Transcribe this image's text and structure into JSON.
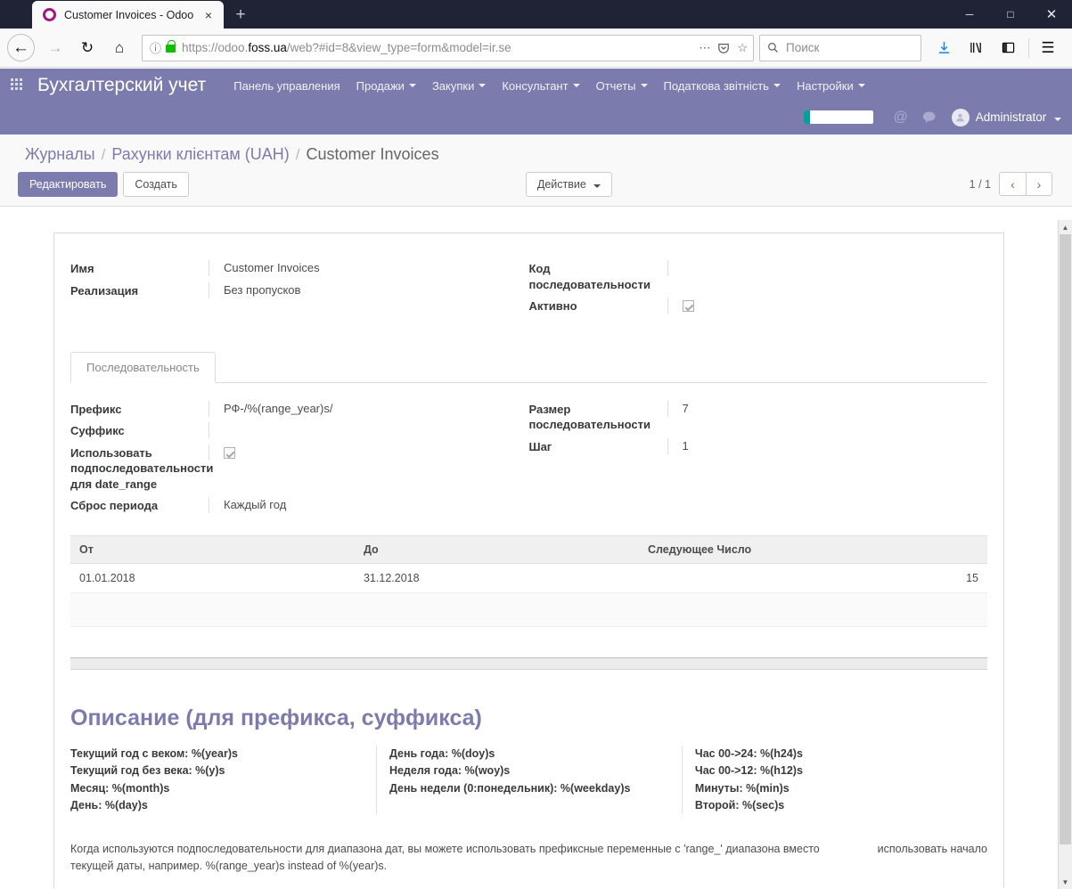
{
  "browser": {
    "tab": {
      "title": "Customer Invoices - Odoo",
      "favicon": "odoo-logo-icon",
      "close": "×"
    },
    "newtab_label": "+",
    "window_controls": {
      "minimize": "─",
      "maximize": "□",
      "close": "✕"
    },
    "nav": {
      "back": "←",
      "forward": "→",
      "reload": "↻",
      "home": "⌂"
    },
    "url": {
      "prefix": "https://odoo.",
      "host_bold": "foss.ua",
      "rest": "/web?#id=8&view_type=form&model=ir.se",
      "info_icon": "ⓘ",
      "lock_icon": "lock-icon"
    },
    "url_icons": {
      "page_actions": "⋯",
      "pocket": "pocket-icon",
      "bookmark": "☆"
    },
    "search": {
      "placeholder": "Поиск",
      "icon": "search-icon"
    },
    "toolbar": {
      "downloads": "↓",
      "library": "library-icon",
      "sidebar": "sidebar-icon",
      "menu": "☰"
    }
  },
  "odoo": {
    "brand": "Бухгалтерский учет",
    "menu": [
      {
        "label": "Панель управления",
        "caret": false
      },
      {
        "label": "Продажи",
        "caret": true
      },
      {
        "label": "Закупки",
        "caret": true
      },
      {
        "label": "Консультант",
        "caret": true
      },
      {
        "label": "Отчеты",
        "caret": true
      },
      {
        "label": "Податкова звітність",
        "caret": true
      },
      {
        "label": "Настройки",
        "caret": true
      }
    ],
    "systray": {
      "mention_icon": "@",
      "chat_icon": "💬",
      "username": "Administrator",
      "avatar": "user-avatar"
    },
    "breadcrumb": {
      "items": [
        {
          "label": "Журналы",
          "current": false
        },
        {
          "label": "Рахунки клієнтам (UAH)",
          "current": false
        },
        {
          "label": "Customer Invoices",
          "current": true
        }
      ],
      "separator": "/"
    },
    "buttons": {
      "edit": "Редактировать",
      "create": "Создать",
      "action": "Действие"
    },
    "pager": {
      "count": "1 / 1",
      "prev": "‹",
      "next": "›"
    }
  },
  "form": {
    "header_left": [
      {
        "label": "Имя",
        "value": "Customer Invoices"
      },
      {
        "label": "Реализация",
        "value": "Без пропусков"
      }
    ],
    "header_right": [
      {
        "label": "Код последовательности",
        "value": ""
      },
      {
        "label": "Активно",
        "value": "",
        "checkbox": true,
        "checked": true
      }
    ],
    "tab_label": "Последовательность",
    "seq_left": [
      {
        "label": "Префикс",
        "value": "РФ-/%(range_year)s/"
      },
      {
        "label": "Суффикс",
        "value": ""
      },
      {
        "label": "Использовать подпоследовательности для date_range",
        "value": "",
        "checkbox": true,
        "checked": true
      },
      {
        "label": "Сброс периода",
        "value": "Каждый год"
      }
    ],
    "seq_right": [
      {
        "label": "Размер последовательности",
        "value": "7"
      },
      {
        "label": "Шаг",
        "value": "1"
      }
    ],
    "table": {
      "columns": [
        "От",
        "До",
        "Следующее Число"
      ],
      "rows": [
        {
          "from": "01.01.2018",
          "to": "31.12.2018",
          "next": "15"
        }
      ]
    },
    "description": {
      "title": "Описание (для префикса, суффикса)",
      "col1": [
        "Текущий год с веком: %(year)s",
        "Текущий год без века: %(y)s",
        "Месяц: %(month)s",
        "День: %(day)s"
      ],
      "col2": [
        "День года: %(doy)s",
        "Неделя года: %(woy)s",
        "День недели (0:понедельник): %(weekday)s"
      ],
      "col3": [
        "Час 00->24: %(h24)s",
        "Час 00->12: %(h12)s",
        "Минуты: %(min)s",
        "Второй: %(sec)s"
      ],
      "note_main": "Когда используются подпоследовательности для диапазона дат, вы можете использовать префиксные переменные с 'range_' диапазона вместо текущей даты, например. %(range_year)s instead of %(year)s.",
      "note_side": "использовать начало"
    }
  },
  "colors": {
    "odoo_purple": "#7c7bad",
    "green": "#00a09d",
    "lock_green": "#12bc00"
  }
}
